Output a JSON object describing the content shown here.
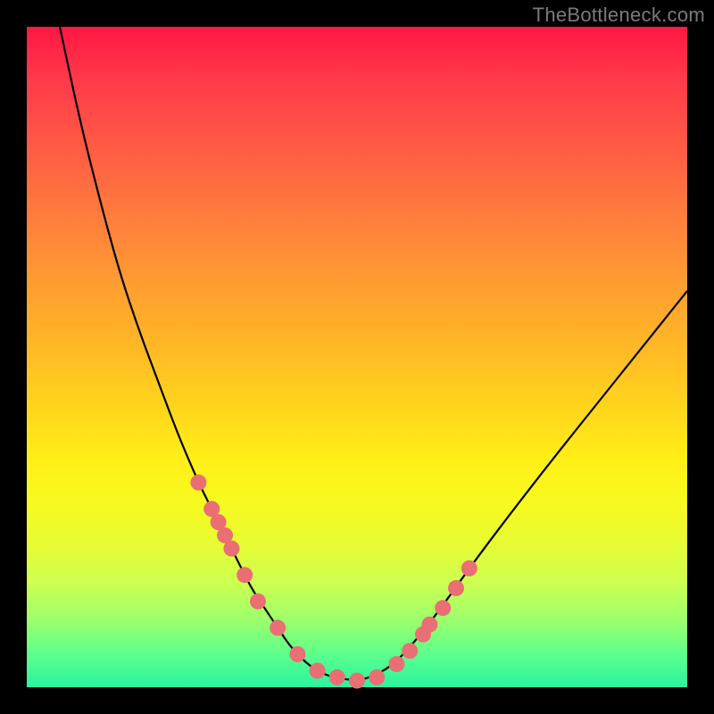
{
  "watermark": "TheBottleneck.com",
  "colors": {
    "frame": "#000000",
    "curve": "#000000",
    "marker": "#e96f74",
    "gradient_top": "#ff1744",
    "gradient_bottom": "#29f4a0"
  },
  "chart_data": {
    "type": "line",
    "title": "",
    "xlabel": "",
    "ylabel": "",
    "xlim": [
      0,
      100
    ],
    "ylim": [
      0,
      100
    ],
    "curve_x": [
      5,
      8,
      11,
      14,
      17,
      20,
      23,
      26,
      28,
      30,
      32,
      34,
      36,
      38,
      40,
      43,
      46,
      50,
      52,
      55,
      58,
      62,
      67,
      73,
      80,
      88,
      96,
      100
    ],
    "curve_y": [
      100,
      86,
      74,
      63,
      54,
      46,
      38,
      31,
      27,
      23,
      19,
      15,
      12,
      9,
      6,
      3,
      1.5,
      1,
      1.5,
      3,
      6,
      11,
      18,
      26,
      35,
      45,
      55,
      60
    ],
    "markers_x": [
      26,
      28,
      29,
      30,
      31,
      33,
      35,
      38,
      41,
      44,
      47,
      50,
      53,
      56,
      58,
      60,
      61,
      63,
      65,
      67
    ],
    "markers_y": [
      31,
      27,
      25,
      23,
      21,
      17,
      13,
      9,
      5,
      2.5,
      1.5,
      1,
      1.5,
      3.5,
      5.5,
      8,
      9.5,
      12,
      15,
      18
    ],
    "description": "V-shaped black curve over a vertical red-to-green gradient; cluster of salmon-colored circular markers along the bottom of the V on both arms."
  }
}
